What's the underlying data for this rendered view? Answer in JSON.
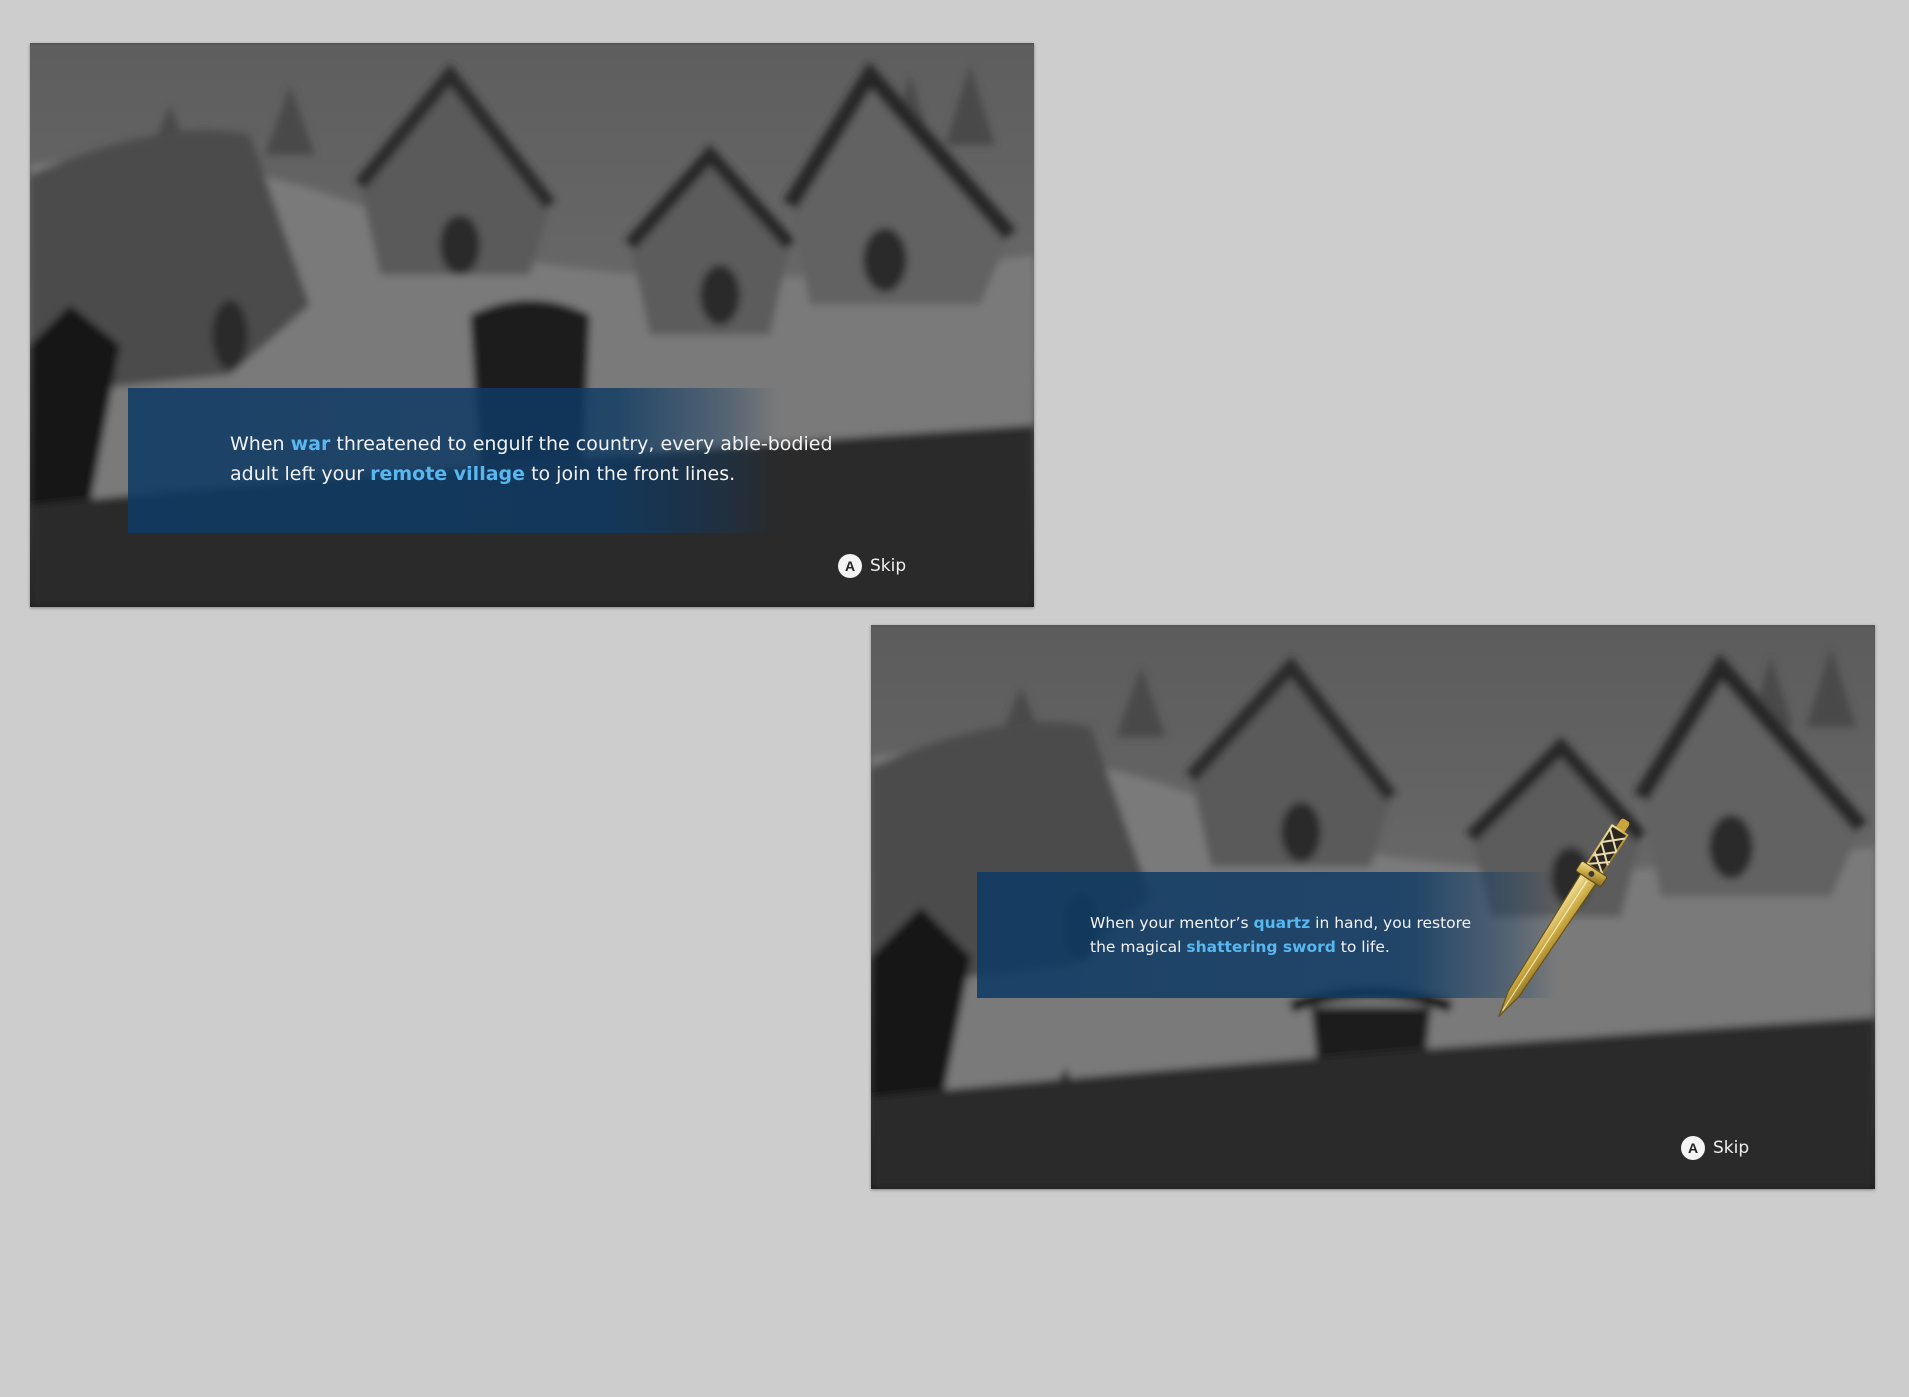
{
  "screens": [
    {
      "story": {
        "line1": [
          {
            "text": "When ",
            "highlight": false
          },
          {
            "text": "war",
            "highlight": true
          },
          {
            "text": " threatened to engulf the country, every able-bodied",
            "highlight": false
          }
        ],
        "line2": [
          {
            "text": "adult left your ",
            "highlight": false
          },
          {
            "text": "remote village",
            "highlight": true
          },
          {
            "text": " to join the front lines.",
            "highlight": false
          }
        ]
      },
      "skip": {
        "button_glyph": "A",
        "label": "Skip"
      }
    },
    {
      "story": {
        "line1": [
          {
            "text": "When your mentor’s ",
            "highlight": false
          },
          {
            "text": "quartz",
            "highlight": true
          },
          {
            "text": " in hand, you restore",
            "highlight": false
          }
        ],
        "line2": [
          {
            "text": "the magical ",
            "highlight": false
          },
          {
            "text": "shattering sword",
            "highlight": true
          },
          {
            "text": " to life.",
            "highlight": false
          }
        ]
      },
      "skip": {
        "button_glyph": "A",
        "label": "Skip"
      },
      "item_icon": "shattering-sword-icon"
    }
  ],
  "colors": {
    "highlight": "#57b7ee",
    "panel": "#0e3a64",
    "page_background": "#cdcdcd"
  }
}
